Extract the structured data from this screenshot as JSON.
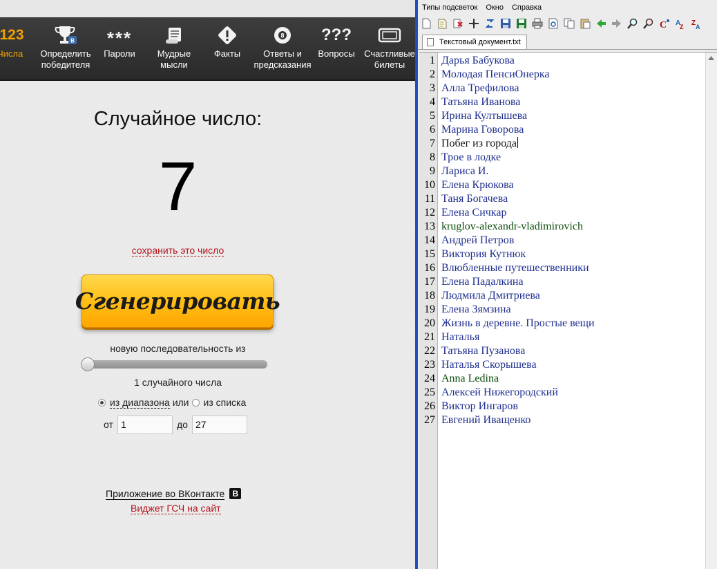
{
  "web": {
    "nav": [
      {
        "label": "Числа",
        "icon": "number-123-icon",
        "active": true
      },
      {
        "label": "Определить\nпобедителя",
        "icon": "trophy-icon",
        "active": false
      },
      {
        "label": "Пароли",
        "icon": "asterisks-icon",
        "active": false
      },
      {
        "label": "Мудрые\nмысли",
        "icon": "scroll-icon",
        "active": false
      },
      {
        "label": "Факты",
        "icon": "exclamation-icon",
        "active": false
      },
      {
        "label": "Ответы и\nпредсказания",
        "icon": "magic-8-ball-icon",
        "active": false
      },
      {
        "label": "Вопросы",
        "icon": "question-marks-icon",
        "active": false
      },
      {
        "label": "Счастливые\nбилеты",
        "icon": "ticket-icon",
        "active": false
      }
    ],
    "number_logo": "123",
    "title": "Случайное число:",
    "result": "7",
    "save_link": "сохранить это число",
    "generate_label": "Сгенерировать",
    "sequence_label": "новую последовательность из",
    "count_label": "1 случайного числа",
    "count_value": 1,
    "mode": {
      "range_label": "из диапазона",
      "or": "или",
      "list_label": "из списка",
      "selected": "range"
    },
    "range": {
      "from_label": "от",
      "from_value": "1",
      "to_label": "до",
      "to_value": "27"
    },
    "vk_app_link": "Приложение во ВКонтакте",
    "vk_badge": "В",
    "widget_link": "Виджет ГСЧ на сайт",
    "colors": {
      "accent": "#f2a300",
      "link": "#b5121b",
      "button": "#ffc21a"
    }
  },
  "editor": {
    "menu": [
      "Типы подсветок",
      "Окно",
      "Справка"
    ],
    "toolbar_icons": [
      "new-file-icon",
      "open-file-icon",
      "close-file-icon",
      "move-icon",
      "refresh-icon",
      "save-icon",
      "save-all-icon",
      "print-icon",
      "preview-icon",
      "copy-icon",
      "paste-icon",
      "back-arrow-icon",
      "forward-arrow-icon",
      "search-icon",
      "replace-icon",
      "case-icon",
      "alpha-sort-icon",
      "z-sort-icon"
    ],
    "tab_title": "Текстовый документ.txt",
    "current_line": 7,
    "lines": [
      {
        "n": "1",
        "text": "Дарья Бабукова"
      },
      {
        "n": "2",
        "text": "Молодая ПенсиОнерка"
      },
      {
        "n": "3",
        "text": "Алла Трефилова"
      },
      {
        "n": "4",
        "text": "Татьяна Иванова"
      },
      {
        "n": "5",
        "text": "Ирина Култышева"
      },
      {
        "n": "6",
        "text": "Марина Говорова"
      },
      {
        "n": "7",
        "text": "Побег из города"
      },
      {
        "n": "8",
        "text": "Трое в лодке"
      },
      {
        "n": "9",
        "text": "Лариса И."
      },
      {
        "n": "10",
        "text": "Елена Крюкова"
      },
      {
        "n": "11",
        "text": "Таня Богачева"
      },
      {
        "n": "12",
        "text": "Елена Сичкар"
      },
      {
        "n": "13",
        "text": "kruglov-alexandr-vladimirovich"
      },
      {
        "n": "14",
        "text": "Андрей Петров"
      },
      {
        "n": "15",
        "text": "Виктория Кутнюк"
      },
      {
        "n": "16",
        "text": "Влюбленные путешественники"
      },
      {
        "n": "17",
        "text": "Елена Падалкина"
      },
      {
        "n": "18",
        "text": "Людмила Дмитриева"
      },
      {
        "n": "19",
        "text": "Елена Зямзина"
      },
      {
        "n": "20",
        "text": "Жизнь в деревне. Простые вещи"
      },
      {
        "n": "21",
        "text": "Наталья"
      },
      {
        "n": "22",
        "text": "Татьяна Пузанова"
      },
      {
        "n": "23",
        "text": "Наталья Скорышева"
      },
      {
        "n": "24",
        "text": "Anna Ledina"
      },
      {
        "n": "25",
        "text": "Алексей Нижегородский"
      },
      {
        "n": "26",
        "text": "Виктор Ингаров"
      },
      {
        "n": "27",
        "text": "Евгений Иващенко"
      }
    ],
    "colors": {
      "text": "#1f2f8f",
      "latin_text": "#0c4d0c",
      "gutter": "#e4e4e4",
      "window_divider": "#1f4fb8"
    }
  }
}
